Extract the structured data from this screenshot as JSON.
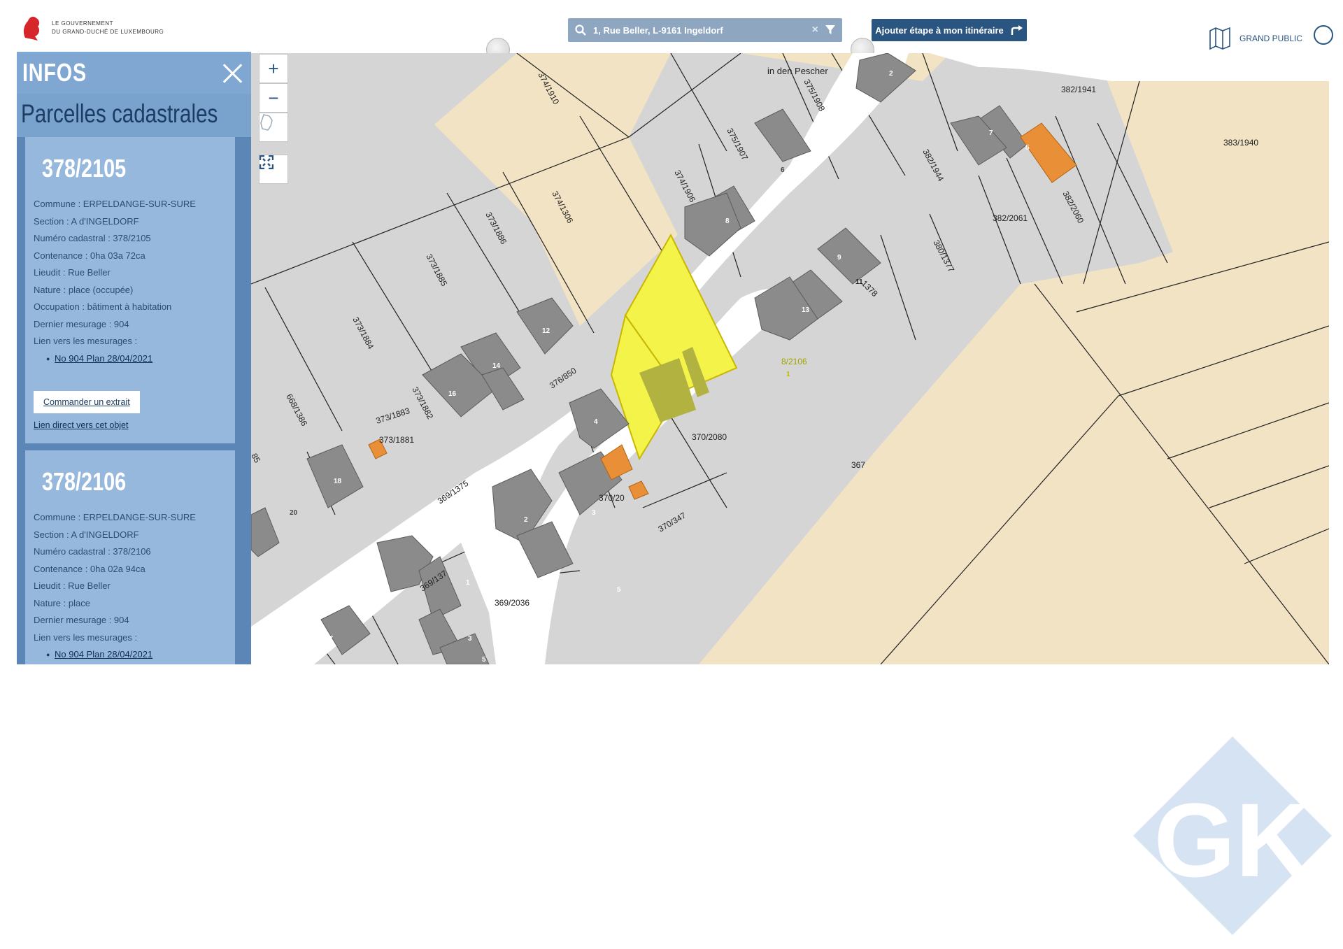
{
  "header": {
    "gov_line1": "LE GOUVERNEMENT",
    "gov_line2": "DU GRAND-DUCHÉ DE LUXEMBOURG",
    "search_value": "1, Rue Beller, L-9161 Ingeldorf",
    "route_button": "Ajouter étape à mon itinéraire",
    "audience": "GRAND PUBLIC"
  },
  "panel": {
    "title": "INFOS",
    "subtitle": "Parcelles cadastrales",
    "parcels": [
      {
        "id": "378/2105",
        "commune": "Commune : ERPELDANGE-SUR-SURE",
        "section": "Section : A d'INGELDORF",
        "numero": "Numéro cadastral : 378/2105",
        "contenance": "Contenance : 0ha 03a 72ca",
        "lieudit": "Lieudit : Rue Beller",
        "nature": "Nature : place (occupée)",
        "occupation": "Occupation : bâtiment à habitation",
        "mesurage": "Dernier mesurage : 904",
        "liens": "Lien vers les mesurages :",
        "plan_link": "No 904 Plan 28/04/2021",
        "order": "Commander un extrait",
        "direct": "Lien direct vers cet objet"
      },
      {
        "id": "378/2106",
        "commune": "Commune : ERPELDANGE-SUR-SURE",
        "section": "Section : A d'INGELDORF",
        "numero": "Numéro cadastral : 378/2106",
        "contenance": "Contenance : 0ha 02a 94ca",
        "lieudit": "Lieudit : Rue Beller",
        "nature": "Nature : place",
        "mesurage": "Dernier mesurage : 904",
        "liens": "Lien vers les mesurages :",
        "plan_link": "No 904 Plan 28/04/2021"
      }
    ]
  },
  "map": {
    "controls": {
      "zoom_in": "+",
      "zoom_out": "−"
    },
    "street_label": "in den Pescher",
    "parcel_labels": [
      "374/1910",
      "375/1908",
      "375/1907",
      "374/1306",
      "374/1906",
      "373/1886",
      "373/1885",
      "373/1884",
      "668/1386",
      "373/1883",
      "373/1882",
      "373/1881",
      "376/850",
      "369/1375",
      "369/137",
      "369/2036",
      "370/2080",
      "370/20",
      "370/347",
      "382/1944",
      "382/1941",
      "383/1940",
      "382/2061",
      "382/2060",
      "380/1377",
      "1378",
      "8/2106",
      "367",
      "85"
    ],
    "house_numbers": [
      "2",
      "5",
      "7",
      "6",
      "8",
      "9",
      "11",
      "13",
      "12",
      "14",
      "16",
      "18",
      "20",
      "4",
      "2",
      "1",
      "3",
      "5",
      "17",
      "3",
      "5",
      "1"
    ]
  },
  "colors": {
    "panel_bg": "#5b86b6",
    "card_bg": "#96b8dc",
    "header_blue": "#2a5580",
    "parcel_grey": "#d5d5d5",
    "building_grey": "#8b8b8b",
    "field_beige": "#f1e3c4",
    "highlight_yellow": "#f3f34a",
    "annex_orange": "#e98f37"
  },
  "watermark": "GK"
}
